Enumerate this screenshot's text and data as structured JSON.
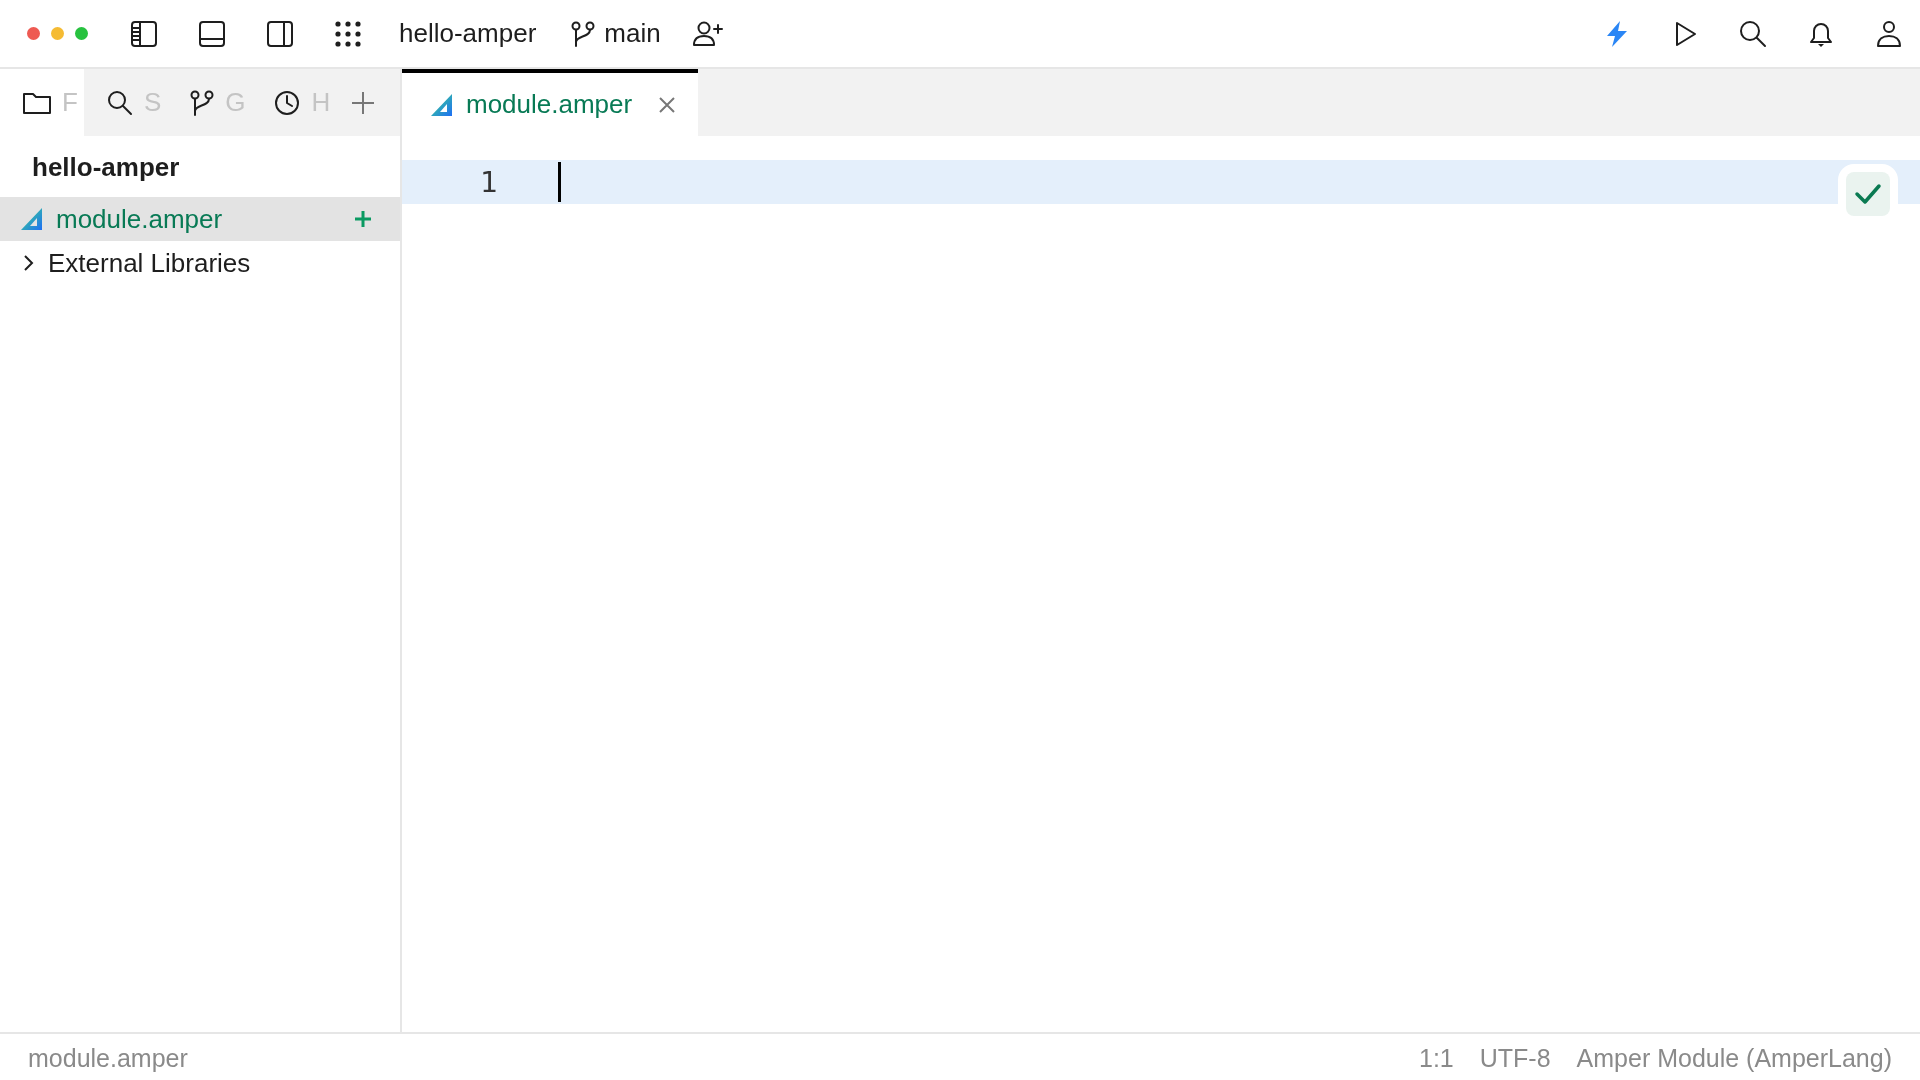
{
  "toolbar": {
    "project": "hello-amper",
    "branch": "main"
  },
  "sidebar": {
    "tabs": [
      {
        "label": "F",
        "selected": true
      },
      {
        "label": "S",
        "selected": false
      },
      {
        "label": "G",
        "selected": false
      },
      {
        "label": "H",
        "selected": false
      }
    ],
    "title": "hello-amper",
    "tree": [
      {
        "kind": "file",
        "label": "module.amper",
        "selected": true
      },
      {
        "kind": "folder",
        "label": "External Libraries",
        "selected": false,
        "expanded": false
      }
    ]
  },
  "editor": {
    "tabs": [
      {
        "label": "module.amper",
        "selected": true
      }
    ],
    "lines": [
      {
        "number": "1",
        "current": true
      }
    ]
  },
  "status_bar": {
    "file": "module.amper",
    "position": "1:1",
    "encoding": "UTF-8",
    "file_type": "Amper Module (AmperLang)"
  }
}
